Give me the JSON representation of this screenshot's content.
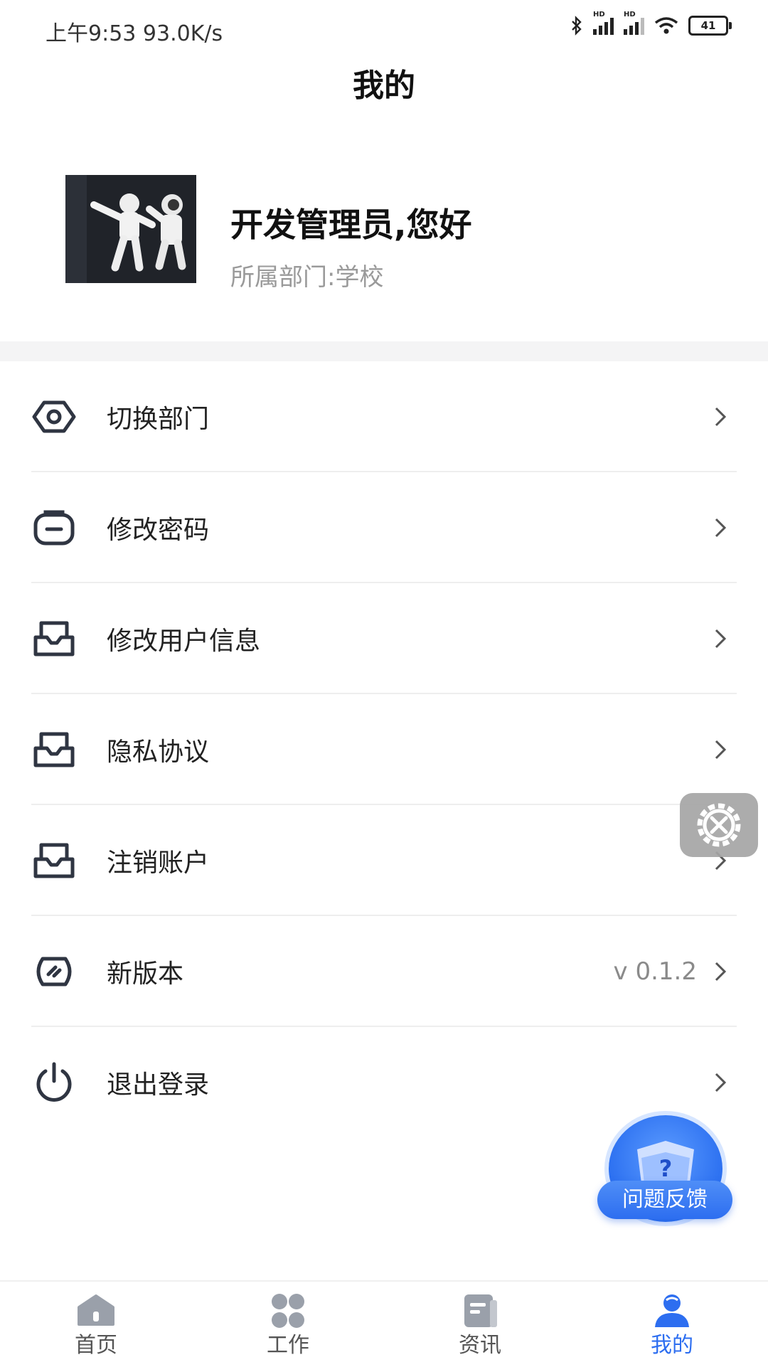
{
  "status_bar": {
    "time_speed": "上午9:53 93.0K/s",
    "battery": "41",
    "hd_label": "HD"
  },
  "header": {
    "title": "我的"
  },
  "profile": {
    "greeting": "开发管理员,您好",
    "department": "所属部门:学校"
  },
  "menu": {
    "items": [
      {
        "label": "切换部门",
        "icon": "hexagon-eye-icon"
      },
      {
        "label": "修改密码",
        "icon": "lock-bag-icon"
      },
      {
        "label": "修改用户信息",
        "icon": "inbox-icon"
      },
      {
        "label": "隐私协议",
        "icon": "inbox-icon"
      },
      {
        "label": "注销账户",
        "icon": "inbox-icon"
      },
      {
        "label": "新版本",
        "icon": "version-badge-icon",
        "value": "v 0.1.2"
      },
      {
        "label": "退出登录",
        "icon": "power-icon"
      }
    ]
  },
  "feedback": {
    "label": "问题反馈"
  },
  "tabbar": {
    "tabs": [
      {
        "label": "首页",
        "icon": "home-icon"
      },
      {
        "label": "工作",
        "icon": "grid-icon"
      },
      {
        "label": "资讯",
        "icon": "news-icon"
      },
      {
        "label": "我的",
        "icon": "user-icon",
        "active": true
      }
    ]
  },
  "colors": {
    "accent": "#2d6ef0",
    "icon_stroke": "#2f3542",
    "muted_text": "#9a9a9a"
  }
}
